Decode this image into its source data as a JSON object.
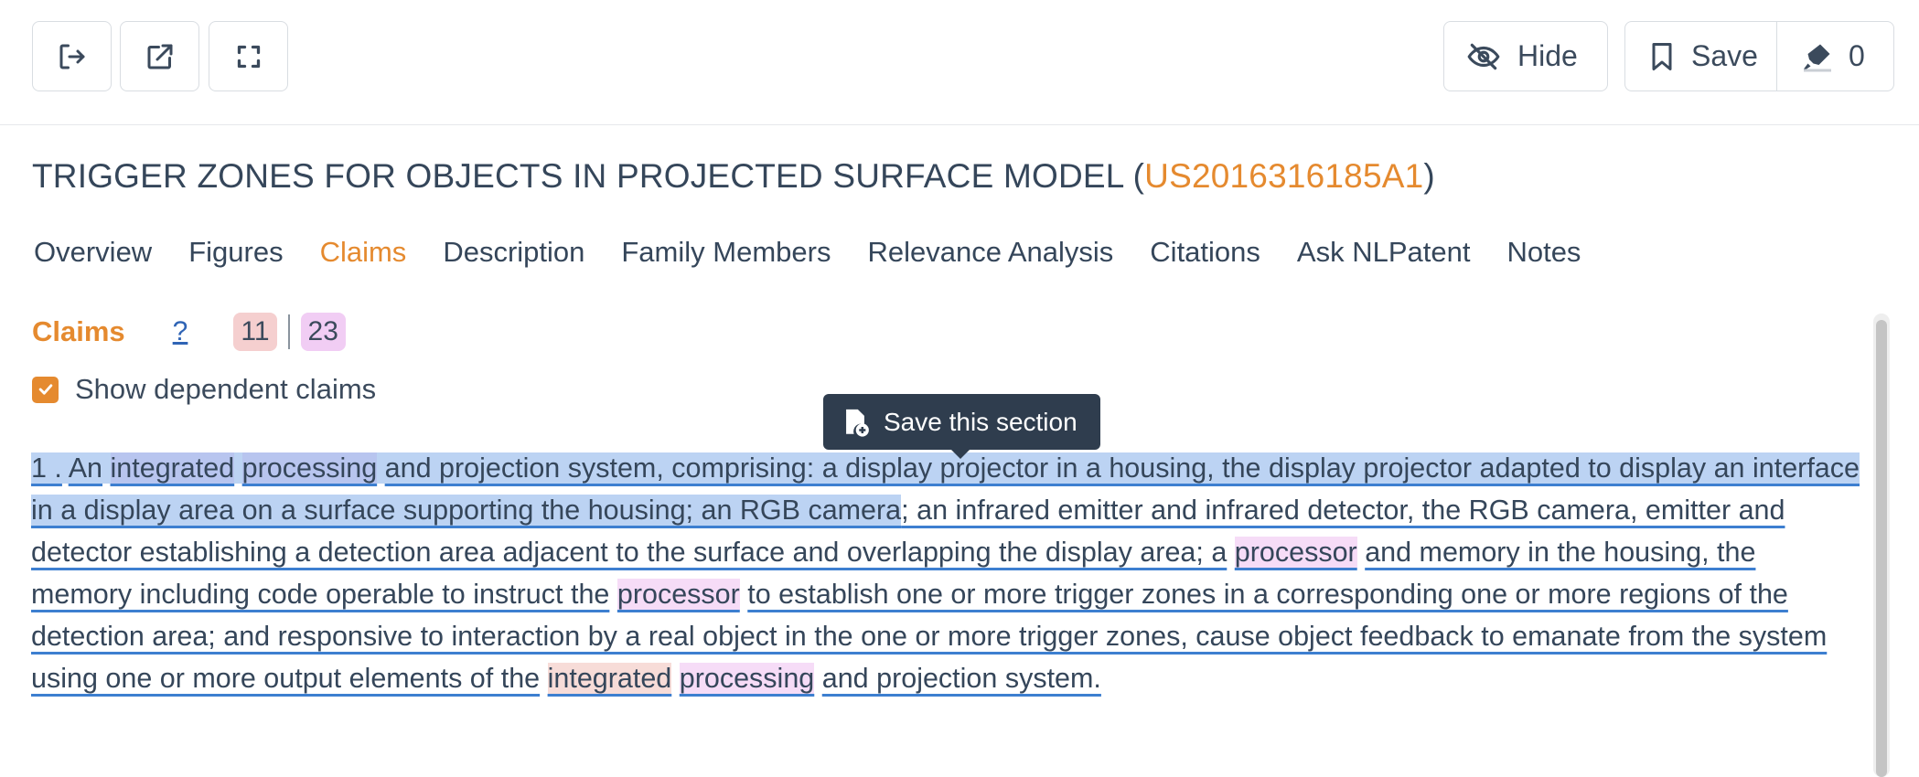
{
  "toolbar": {
    "hide_label": "Hide",
    "save_label": "Save",
    "annotations_count": "0"
  },
  "patent": {
    "title_text": "TRIGGER ZONES FOR OBJECTS IN PROJECTED SURFACE MODEL (",
    "id": "US2016316185A1",
    "title_close": ")"
  },
  "tabs": [
    "Overview",
    "Figures",
    "Claims",
    "Description",
    "Family Members",
    "Relevance Analysis",
    "Citations",
    "Ask NLPatent",
    "Notes"
  ],
  "active_tab": "Claims",
  "claims": {
    "label": "Claims",
    "help": "?",
    "badge_red": "11",
    "badge_pink": "23",
    "show_dependent_label": "Show dependent claims",
    "show_dependent_checked": true
  },
  "tooltip": {
    "label": "Save this section"
  },
  "claim_text": {
    "number": "1 .",
    "seg_an": "An",
    "seg_integrated": "integrated",
    "seg_processing": "processing",
    "seg_1": "and projection system, comprising: a display projector in a housing, the display projector adapted to display an interface in a display area on a surface supporting the housing; an RGB camera",
    "seg_2": "; an infrared emitter and infrared detector, the RGB camera, emitter and detector establishing a detection area adjacent to the surface and overlapping the display area; a",
    "seg_processor1": "processor",
    "seg_3": "and memory in the housing, the memory including code operable to instruct the",
    "seg_processor2": "processor",
    "seg_4": "to establish one or more trigger zones in a corresponding one or more regions of the detection area; and responsive to interaction by a real object in the one or more trigger zones, cause object feedback to emanate from the system using one or more output elements of the",
    "seg_integrated2": "integrated",
    "seg_processing2": "processing",
    "seg_5": "and projection system."
  },
  "colors": {
    "accent": "#e58a2f",
    "text": "#35465a",
    "selection": "#bcd3f3",
    "highlight_red": "#f5cfcf",
    "highlight_pink": "#f1cdf4",
    "underline": "#3d7fd0"
  }
}
